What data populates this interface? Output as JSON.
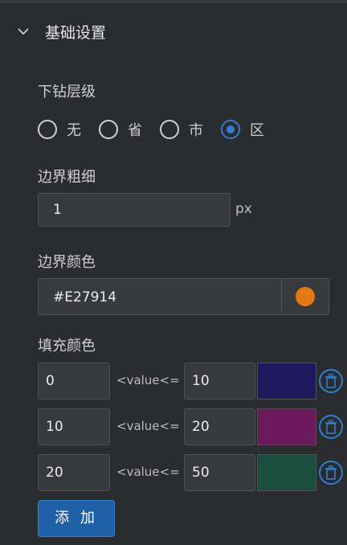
{
  "section": {
    "title": "基础设置"
  },
  "drill": {
    "label": "下钻层级",
    "options": [
      "无",
      "省",
      "市",
      "区"
    ],
    "selected": "区"
  },
  "border_width": {
    "label": "边界粗细",
    "value": "1",
    "unit": "px"
  },
  "border_color": {
    "label": "边界颜色",
    "value": "#E27914"
  },
  "fill_color": {
    "label": "填充颜色",
    "operator": "<value<=",
    "ranges": [
      {
        "min": "0",
        "max": "10",
        "color": "#1f1a5e"
      },
      {
        "min": "10",
        "max": "20",
        "color": "#6b1a5c"
      },
      {
        "min": "20",
        "max": "50",
        "color": "#1a4e3d"
      }
    ]
  },
  "add_button": {
    "label": "添 加"
  },
  "colors": {
    "accent": "#2f7fd0",
    "button": "#1f5fa6",
    "background": "#2b2c2f"
  },
  "icons": {
    "collapse": "chevron-down-icon",
    "delete": "trash-icon"
  }
}
